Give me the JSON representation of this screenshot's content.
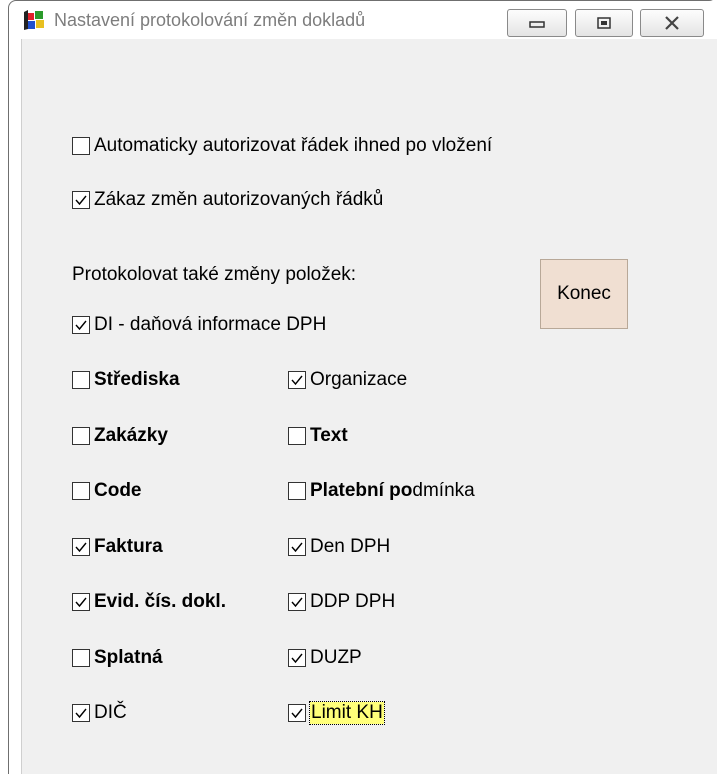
{
  "window": {
    "title": "Nastavení protokolování změn dokladů"
  },
  "options": {
    "auto_authorize": {
      "label": "Automaticky autorizovat řádek ihned po vložení",
      "checked": false
    },
    "forbid_changes": {
      "label": "Zákaz změn autorizovaných řádků",
      "checked": true
    }
  },
  "section_label": "Protokolovat také změny položek:",
  "konec_label": "Konec",
  "items": {
    "di": {
      "label": "DI - daňová informace DPH",
      "checked": true
    },
    "strediska": {
      "label": "Střediska",
      "checked": false
    },
    "organizace": {
      "label": "Organizace",
      "checked": true
    },
    "zakazky": {
      "label": "Zakázky",
      "checked": false
    },
    "text": {
      "label": "Text",
      "checked": false
    },
    "code": {
      "label": "Code",
      "checked": false
    },
    "platebni_bold": "Platební po",
    "platebni_rest": "dmínka",
    "platebni_checked": false,
    "faktura": {
      "label": "Faktura",
      "checked": true
    },
    "den_dph": {
      "label": "Den DPH",
      "checked": true
    },
    "evid": {
      "label": "Evid. čís. dokl.",
      "checked": true
    },
    "ddp_dph": {
      "label": "DDP DPH",
      "checked": true
    },
    "splatna": {
      "label": "Splatná",
      "checked": false
    },
    "duzp": {
      "label": "DUZP",
      "checked": true
    },
    "dic": {
      "label": "DIČ",
      "checked": true
    },
    "limit_kh": {
      "label": "Limit KH",
      "checked": true
    }
  },
  "colors": {
    "konec_bg": "#f0dfd2",
    "focus_highlight": "#ffff7a",
    "title_text": "#7d7d7d"
  }
}
